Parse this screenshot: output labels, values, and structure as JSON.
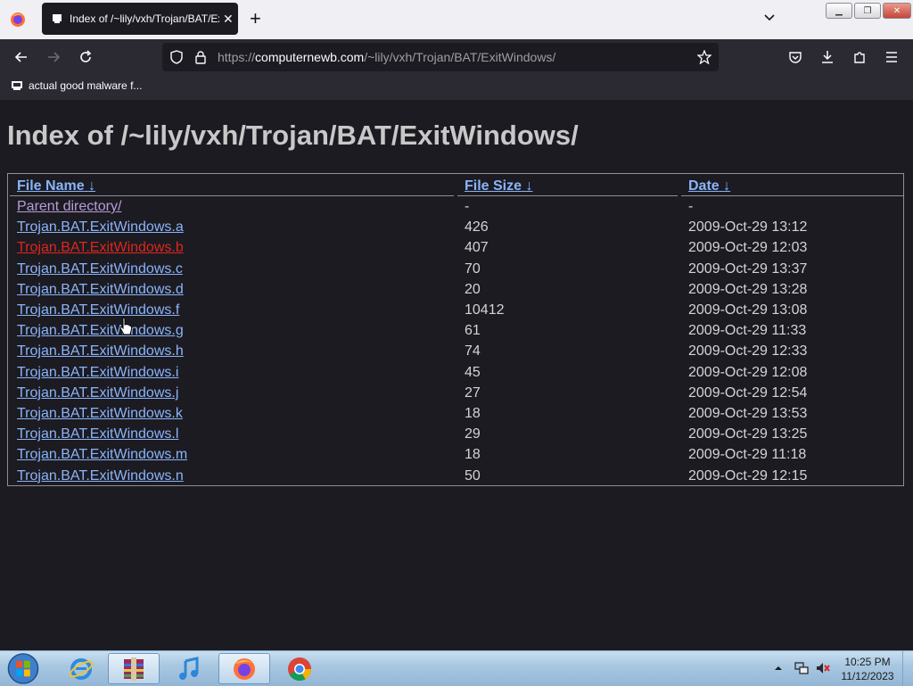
{
  "browser": {
    "tab_title": "Index of /~lily/vxh/Trojan/BAT/ExitWindows/",
    "url_prefix": "https://",
    "url_domain": "computernewb.com",
    "url_path": "/~lily/vxh/Trojan/BAT/ExitWindows/",
    "bookmark_label": "actual good malware f..."
  },
  "page": {
    "title": "Index of /~lily/vxh/Trojan/BAT/ExitWindows/",
    "columns": {
      "name": "File Name",
      "size": "File Size",
      "date": "Date",
      "sort_arrow": "↓"
    },
    "rows": [
      {
        "name": "Parent directory/",
        "size": "-",
        "date": "-",
        "state": "visited"
      },
      {
        "name": "Trojan.BAT.ExitWindows.a",
        "size": "426",
        "date": "2009-Oct-29 13:12",
        "state": ""
      },
      {
        "name": "Trojan.BAT.ExitWindows.b",
        "size": "407",
        "date": "2009-Oct-29 12:03",
        "state": "active"
      },
      {
        "name": "Trojan.BAT.ExitWindows.c",
        "size": "70",
        "date": "2009-Oct-29 13:37",
        "state": ""
      },
      {
        "name": "Trojan.BAT.ExitWindows.d",
        "size": "20",
        "date": "2009-Oct-29 13:28",
        "state": ""
      },
      {
        "name": "Trojan.BAT.ExitWindows.f",
        "size": "10412",
        "date": "2009-Oct-29 13:08",
        "state": ""
      },
      {
        "name": "Trojan.BAT.ExitWindows.g",
        "size": "61",
        "date": "2009-Oct-29 11:33",
        "state": ""
      },
      {
        "name": "Trojan.BAT.ExitWindows.h",
        "size": "74",
        "date": "2009-Oct-29 12:33",
        "state": ""
      },
      {
        "name": "Trojan.BAT.ExitWindows.i",
        "size": "45",
        "date": "2009-Oct-29 12:08",
        "state": ""
      },
      {
        "name": "Trojan.BAT.ExitWindows.j",
        "size": "27",
        "date": "2009-Oct-29 12:54",
        "state": ""
      },
      {
        "name": "Trojan.BAT.ExitWindows.k",
        "size": "18",
        "date": "2009-Oct-29 13:53",
        "state": ""
      },
      {
        "name": "Trojan.BAT.ExitWindows.l",
        "size": "29",
        "date": "2009-Oct-29 13:25",
        "state": ""
      },
      {
        "name": "Trojan.BAT.ExitWindows.m",
        "size": "18",
        "date": "2009-Oct-29 11:18",
        "state": ""
      },
      {
        "name": "Trojan.BAT.ExitWindows.n",
        "size": "50",
        "date": "2009-Oct-29 12:15",
        "state": ""
      }
    ]
  },
  "taskbar": {
    "time": "10:25 PM",
    "date": "11/12/2023",
    "apps": [
      "internet-explorer-icon",
      "winrar-icon",
      "itunes-icon",
      "firefox-icon",
      "chrome-icon"
    ]
  },
  "colors": {
    "link": "#8ab4f8",
    "visited": "#b79cd7",
    "active": "#e1251b",
    "page_bg": "#1c1b22"
  }
}
